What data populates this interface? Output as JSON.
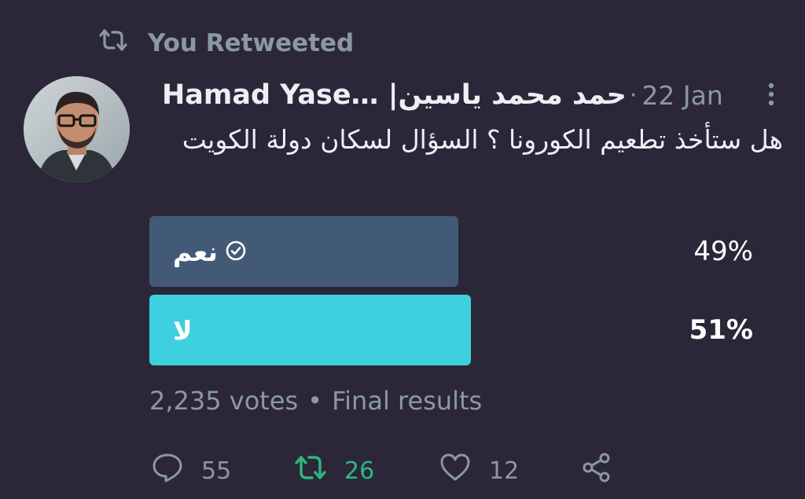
{
  "retweet_banner": {
    "text": "You Retweeted",
    "icon": "retweet-icon"
  },
  "tweet": {
    "author_name": "Hamad Yase… |حمد محمد ياسين",
    "separator": "·",
    "date": "22 Jan",
    "text": "هل ستأخذ تطعيم الكورونا ؟ السؤال لسكان دولة الكويت"
  },
  "poll": {
    "options": [
      {
        "label": "نعم",
        "percent_text": "49%",
        "percent": 49,
        "voted": true,
        "color": "#425a75"
      },
      {
        "label": "لا",
        "percent_text": "51%",
        "percent": 51,
        "voted": false,
        "winner": true,
        "color": "#3fd0e0"
      }
    ],
    "votes": "2,235 votes",
    "meta_separator": "•",
    "status": "Final results"
  },
  "actions": {
    "replies": "55",
    "retweets": "26",
    "likes": "12",
    "retweet_active_color": "#2db880"
  },
  "colors": {
    "background": "#2b2738",
    "secondary_text": "#8b98a4"
  }
}
